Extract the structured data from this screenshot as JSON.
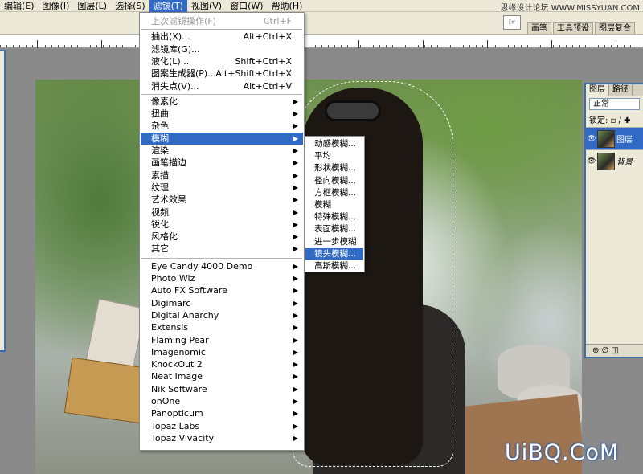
{
  "menubar": {
    "items": [
      "编辑(E)",
      "图像(I)",
      "图层(L)",
      "选择(S)",
      "滤镜(T)",
      "视图(V)",
      "窗口(W)",
      "帮助(H)"
    ],
    "active_index": 4
  },
  "watermark_top": "思缘设计论坛 WWW.MISSYUAN.COM",
  "watermark_bottom": "UiBQ.CoM",
  "palette_well": {
    "icon_label": "☞",
    "tabs": [
      "画笔",
      "工具预设",
      "图层复合"
    ]
  },
  "layers_panel": {
    "tabs": [
      "图层",
      "路径"
    ],
    "blend_mode": "正常",
    "lock_label": "锁定:",
    "layers": [
      {
        "name": "图层",
        "selected": true
      },
      {
        "name": "背景",
        "selected": false
      }
    ],
    "bottom_icons": "⊕ ∅ ◫"
  },
  "filter_menu": {
    "items": [
      {
        "label": "上次滤镜操作(F)",
        "shortcut": "Ctrl+F",
        "disabled": true
      },
      {
        "label": "抽出(X)...",
        "shortcut": "Alt+Ctrl+X"
      },
      {
        "label": "滤镜库(G)..."
      },
      {
        "label": "液化(L)...",
        "shortcut": "Shift+Ctrl+X"
      },
      {
        "label": "图案生成器(P)...",
        "shortcut": "Alt+Shift+Ctrl+X"
      },
      {
        "label": "消失点(V)...",
        "shortcut": "Alt+Ctrl+V"
      },
      {
        "label": "像素化",
        "submenu": true
      },
      {
        "label": "扭曲",
        "submenu": true
      },
      {
        "label": "杂色",
        "submenu": true
      },
      {
        "label": "模糊",
        "submenu": true,
        "highlighted": true
      },
      {
        "label": "渲染",
        "submenu": true
      },
      {
        "label": "画笔描边",
        "submenu": true
      },
      {
        "label": "素描",
        "submenu": true
      },
      {
        "label": "纹理",
        "submenu": true
      },
      {
        "label": "艺术效果",
        "submenu": true
      },
      {
        "label": "视频",
        "submenu": true
      },
      {
        "label": "锐化",
        "submenu": true
      },
      {
        "label": "风格化",
        "submenu": true
      },
      {
        "label": "其它",
        "submenu": true
      },
      {
        "label": "Eye Candy 4000 Demo",
        "submenu": true
      },
      {
        "label": "Photo Wiz",
        "submenu": true
      },
      {
        "label": "Auto FX Software",
        "submenu": true
      },
      {
        "label": "Digimarc",
        "submenu": true
      },
      {
        "label": "Digital Anarchy",
        "submenu": true
      },
      {
        "label": "Extensis",
        "submenu": true
      },
      {
        "label": "Flaming Pear",
        "submenu": true
      },
      {
        "label": "Imagenomic",
        "submenu": true
      },
      {
        "label": "KnockOut 2",
        "submenu": true
      },
      {
        "label": "Neat Image",
        "submenu": true
      },
      {
        "label": "Nik Software",
        "submenu": true
      },
      {
        "label": "onOne",
        "submenu": true
      },
      {
        "label": "Panopticum",
        "submenu": true
      },
      {
        "label": "Topaz Labs",
        "submenu": true
      },
      {
        "label": "Topaz Vivacity",
        "submenu": true
      }
    ]
  },
  "blur_submenu": {
    "items": [
      {
        "label": "动感模糊..."
      },
      {
        "label": "平均"
      },
      {
        "label": "形状模糊..."
      },
      {
        "label": "径向模糊..."
      },
      {
        "label": "方框模糊..."
      },
      {
        "label": "模糊"
      },
      {
        "label": "特殊模糊..."
      },
      {
        "label": "表面模糊..."
      },
      {
        "label": "进一步模糊"
      },
      {
        "label": "镜头模糊...",
        "highlighted": true
      },
      {
        "label": "高斯模糊..."
      }
    ]
  }
}
